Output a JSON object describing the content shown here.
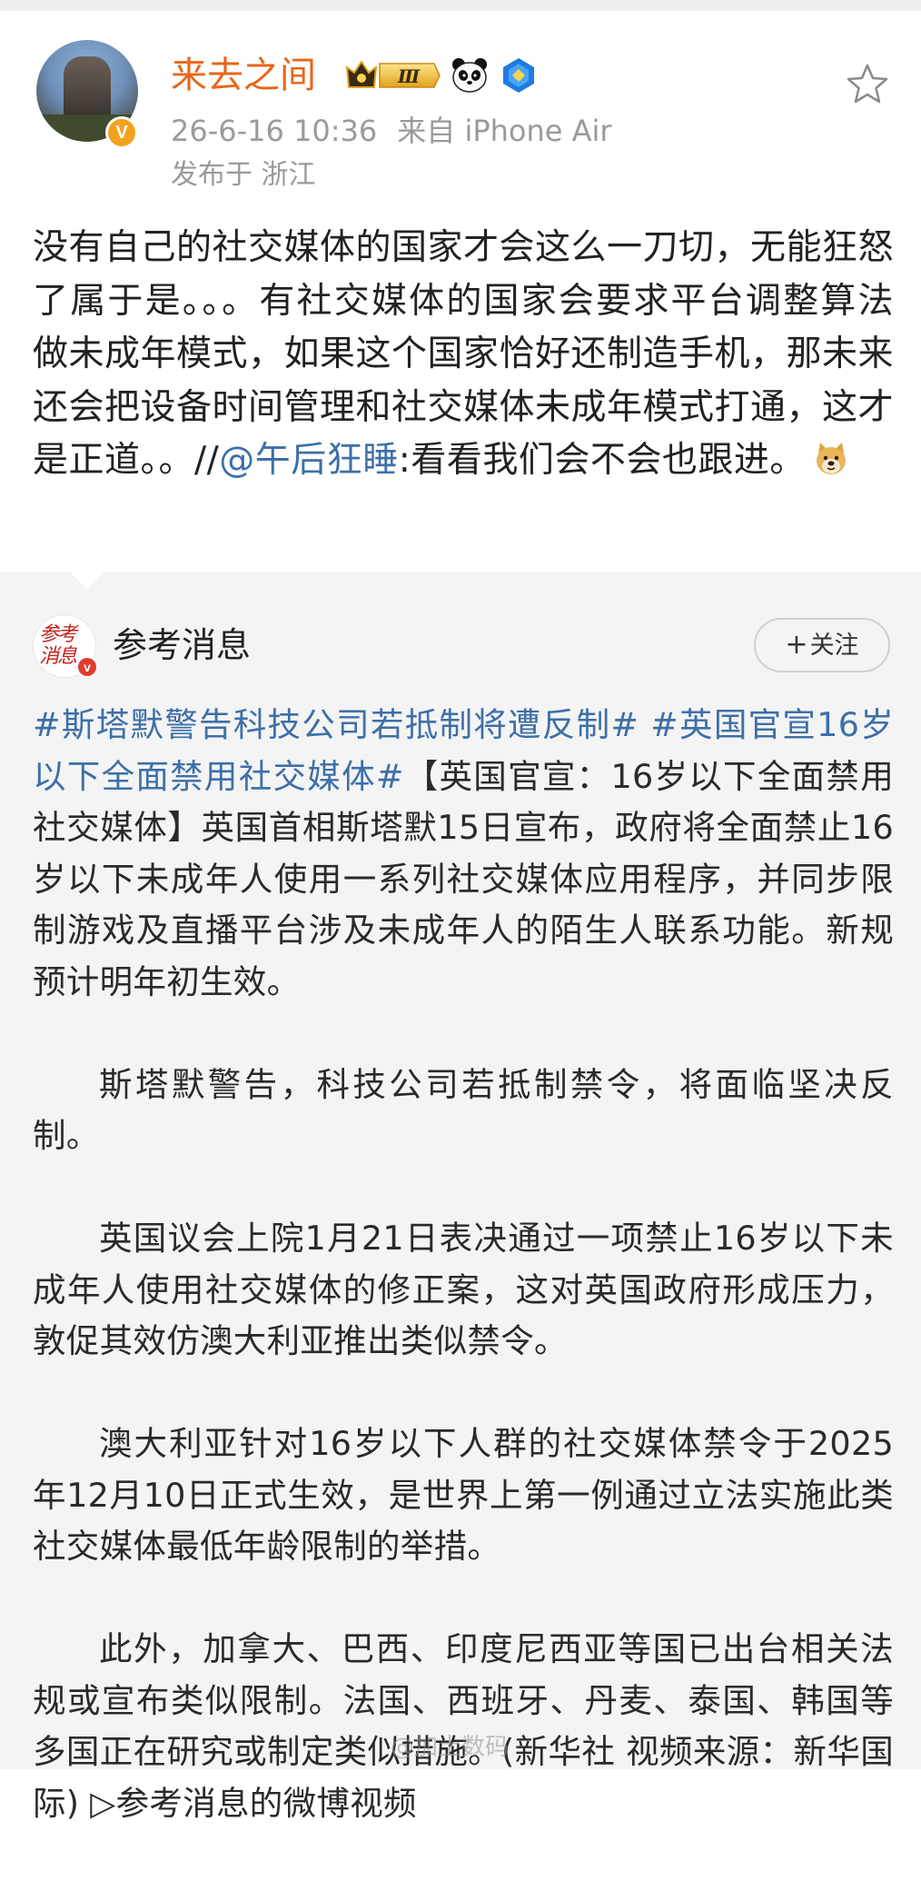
{
  "post": {
    "username": "来去之间",
    "timestamp": "26-6-16 10:36",
    "source": "来自 iPhone Air",
    "location": "发布于 浙江",
    "text_part1": "没有自己的社交媒体的国家才会这么一刀切，无能狂怒了属于是。。。有社交媒体的国家会要求平台调整算法做未成年模式，如果这个国家恰好还制造手机，那未来还会把设备时间管理和社交媒体未成年模式打通，这才是正道。。//",
    "mention": "@午后狂睡",
    "text_part2": ":看看我们会不会也跟进。",
    "emoji": "doge-emoji",
    "vip_badge_level": "Ⅲ",
    "verified_mark": "V"
  },
  "repost": {
    "author": "参考消息",
    "avatar_text": "参考消息",
    "verified_mark": "v",
    "follow_label": "关注",
    "follow_plus": "+",
    "tag1": "#斯塔默警告科技公司若抵制将遭反制#",
    "tag2": "#英国官宣16岁以下全面禁用社交媒体#",
    "paragraph1": "【英国官宣：16岁以下全面禁用社交媒体】英国首相斯塔默15日宣布，政府将全面禁止16岁以下未成年人使用一系列社交媒体应用程序，并同步限制游戏及直播平台涉及未成年人的陌生人联系功能。新规预计明年初生效。",
    "paragraph2": "斯塔默警告，科技公司若抵制禁令，将面临坚决反制。",
    "paragraph3": "英国议会上院1月21日表决通过一项禁止16岁以下未成年人使用社交媒体的修正案，这对英国政府形成压力，敦促其效仿澳大利亚推出类似禁令。",
    "paragraph4": "澳大利亚针对16岁以下人群的社交媒体禁令于2025年12月10日正式生效，是世界上第一例通过立法实施此类社交媒体最低年龄限制的举措。",
    "paragraph5": "此外，加拿大、巴西、印度尼西亚等国已出台相关法规或宣布类似限制。法国、西班牙、丹麦、泰国、韩国等多国正在研究或制定类似措施。(新华社 视频来源：新华国际) ▷参考消息的微博视频"
  },
  "watermark": "@加土数码",
  "colors": {
    "username": "#e8661a",
    "link": "#3d6fa8",
    "meta": "#9a9a9a",
    "repost_bg": "#f4f4f4",
    "verified_orange": "#f2a21b",
    "verified_red": "#e23b2e"
  },
  "icons": [
    "star-icon",
    "crown-vip-badge-icon",
    "panda-icon",
    "blue-diamond-badge-icon",
    "doge-emoji",
    "verified-badge-icon"
  ]
}
